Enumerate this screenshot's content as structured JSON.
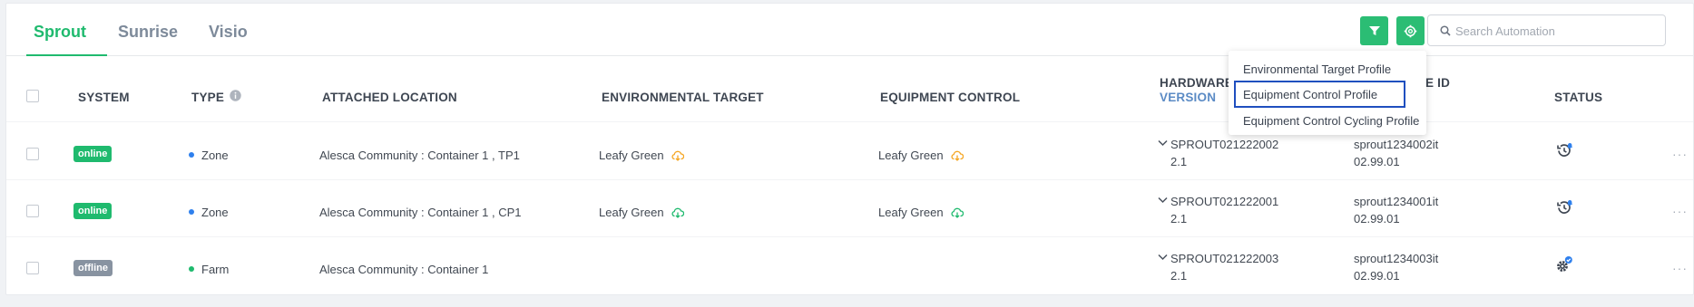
{
  "tabs": [
    {
      "label": "Sprout",
      "active": true
    },
    {
      "label": "Sunrise",
      "active": false
    },
    {
      "label": "Visio",
      "active": false
    }
  ],
  "toolbar": {
    "filter_icon": "filter-icon",
    "settings_icon": "gear-icon",
    "search_placeholder": "Search Automation",
    "search_value": ""
  },
  "table": {
    "headers": {
      "system": "SYSTEM",
      "type": "TYPE",
      "attached_location": "ATTACHED LOCATION",
      "environmental_target": "ENVIRONMENTAL TARGET",
      "equipment_control": "EQUIPMENT CONTROL",
      "hardware_line1": "HARDWARE",
      "hardware_line2": "VERSION",
      "device_id_suffix": "E ID",
      "status": "STATUS"
    },
    "rows": [
      {
        "system": "online",
        "type": "Zone",
        "location": "Alesca Community : Container 1 , TP1",
        "env_target": "Leafy Green",
        "equipment": "Leafy Green",
        "hardware": "SPROUT021222002",
        "hw_version": "2.1",
        "device": "sprout1234002it",
        "device_version": "02.99.01"
      },
      {
        "system": "online",
        "type": "Zone",
        "location": "Alesca Community : Container 1 , CP1",
        "env_target": "Leafy Green",
        "equipment": "Leafy Green",
        "hardware": "SPROUT021222001",
        "hw_version": "2.1",
        "device": "sprout1234001it",
        "device_version": "02.99.01"
      },
      {
        "system": "offline",
        "type": "Farm",
        "location": "Alesca Community : Container 1",
        "env_target": "",
        "equipment": "",
        "hardware": "SPROUT021222003",
        "hw_version": "2.1",
        "device": "sprout1234003it",
        "device_version": "02.99.01"
      }
    ]
  },
  "dropdown": {
    "items": [
      "Environmental Target Profile",
      "Equipment Control Profile",
      "Equipment Control Cycling Profile"
    ],
    "highlighted": "Equipment Control Profile"
  },
  "colors": {
    "accent": "#1fba6e",
    "zone_dot": "#2f80ed",
    "farm_dot": "#1fba6e",
    "cloud_orange": "#f5a623",
    "cloud_green": "#1fba6e",
    "bell_blue": "#2f80ed"
  }
}
